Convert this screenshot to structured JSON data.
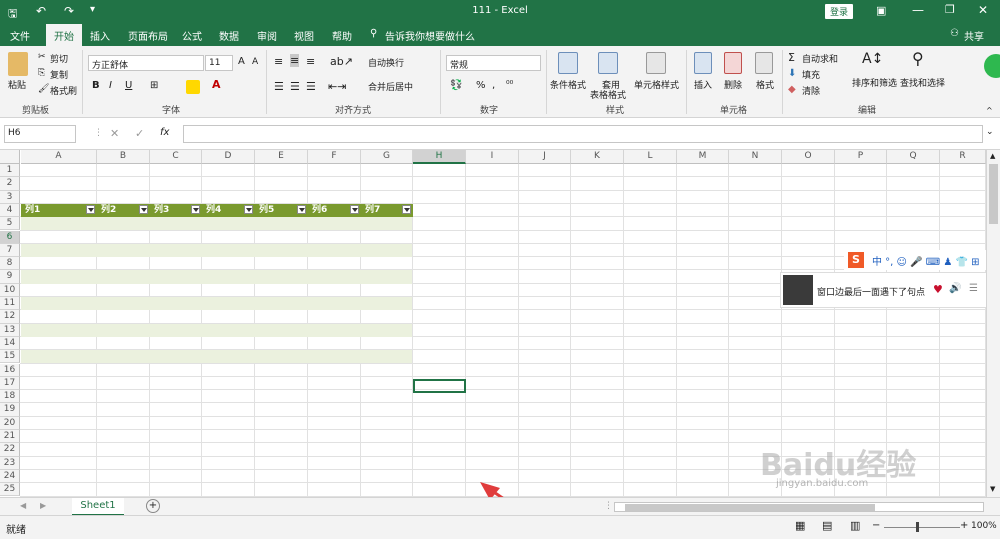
{
  "window": {
    "title": "111 - Excel",
    "login_label": "登录",
    "share_label": "共享"
  },
  "tabs": [
    "文件",
    "开始",
    "插入",
    "页面布局",
    "公式",
    "数据",
    "审阅",
    "视图",
    "帮助"
  ],
  "tell_me": "告诉我你想要做什么",
  "ribbon": {
    "clipboard": {
      "paste": "粘贴",
      "cut": "剪切",
      "copy": "复制",
      "painter": "格式刷",
      "label": "剪贴板"
    },
    "font": {
      "name": "方正舒体",
      "size": "11",
      "bold": "B",
      "italic": "I",
      "underline": "U",
      "label": "字体"
    },
    "alignment": {
      "wrap": "自动换行",
      "merge": "合并后居中",
      "label": "对齐方式"
    },
    "number": {
      "format": "常规",
      "percent": "%",
      "comma": ",",
      "label": "数字"
    },
    "styles": {
      "conditional": "条件格式",
      "table1": "套用",
      "table2": "表格格式",
      "cell": "单元格样式",
      "label": "样式"
    },
    "cells": {
      "insert": "插入",
      "delete": "删除",
      "format": "格式",
      "label": "单元格"
    },
    "editing": {
      "autosum": "自动求和",
      "fill": "填充",
      "clear": "清除",
      "sort": "排序和筛选",
      "find": "查找和选择",
      "label": "编辑"
    }
  },
  "formula_bar": {
    "name_box": "H6",
    "fx": "fx",
    "value": ""
  },
  "columns": [
    "A",
    "B",
    "C",
    "D",
    "E",
    "F",
    "G",
    "H",
    "I",
    "J",
    "K",
    "L",
    "M",
    "N",
    "O",
    "P",
    "Q",
    "R"
  ],
  "rows": [
    "1",
    "2",
    "3",
    "4",
    "5",
    "6",
    "7",
    "8",
    "9",
    "10",
    "11",
    "12",
    "13",
    "14",
    "15",
    "16",
    "17",
    "18",
    "19",
    "20",
    "21",
    "22",
    "23",
    "24",
    "25"
  ],
  "table_headers": [
    "列1",
    "列2",
    "列3",
    "列4",
    "列5",
    "列6",
    "列7"
  ],
  "sheet_tab": "Sheet1",
  "status": {
    "ready": "就绪",
    "zoom": "100%"
  },
  "im_popup": {
    "text": "窗口边最后一面遇下了句点"
  },
  "watermark": {
    "brand": "Baidu经验",
    "url": "jingyan.baidu.com"
  },
  "colors": {
    "excel_green": "#217346",
    "table_header": "#7a9a2e",
    "band": "#ebf1de",
    "arrow": "#e03c3c"
  }
}
